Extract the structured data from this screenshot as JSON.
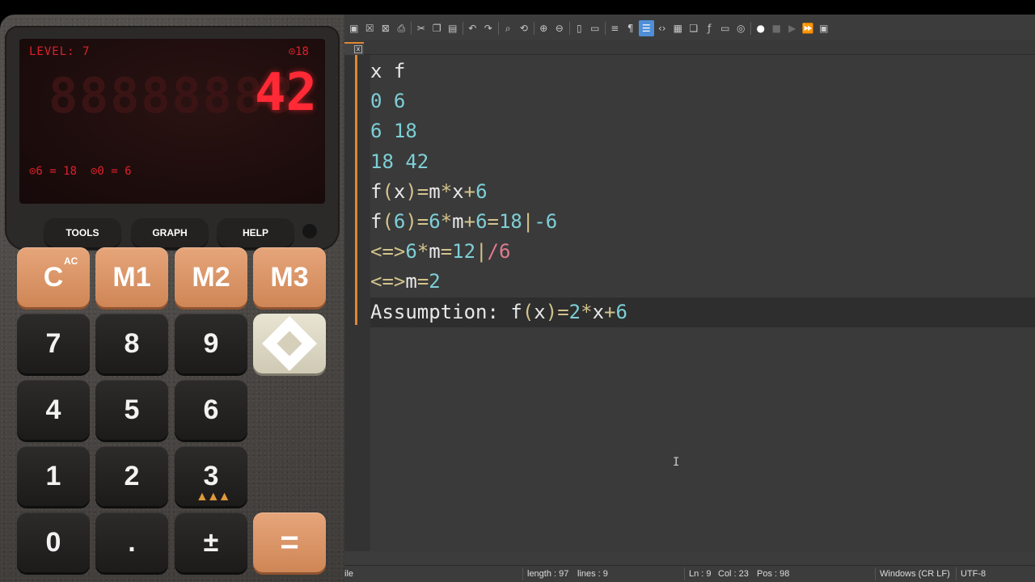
{
  "calculator": {
    "display": {
      "level": "LEVEL: 7",
      "top_right": "⊙18",
      "ghost_digits": "88888888",
      "value": "42",
      "memory_1": "⊙6 = 18",
      "memory_2": "⊙0 = 6"
    },
    "softkeys": [
      "TOOLS",
      "GRAPH",
      "HELP"
    ],
    "keys": {
      "clear": "C",
      "clear_sup": "AC",
      "m1": "M1",
      "m2": "M2",
      "m3": "M3",
      "seven": "7",
      "eight": "8",
      "nine": "9",
      "four": "4",
      "five": "5",
      "six": "6",
      "one": "1",
      "two": "2",
      "three": "3",
      "zero": "0",
      "dot": ".",
      "plus_minus": "±",
      "equals": "="
    },
    "colors": {
      "orange": "#dd996c",
      "dark_key": "#242322",
      "lcd_red": "#ff2a35"
    }
  },
  "editor": {
    "toolbar_icons": [
      "save-icon",
      "close-icon",
      "close-all-icon",
      "print-icon",
      "cut-icon",
      "copy-icon",
      "paste-icon",
      "undo-icon",
      "redo-icon",
      "find-icon",
      "replace-icon",
      "zoom-in-icon",
      "zoom-out-icon",
      "sync-v-icon",
      "sync-h-icon",
      "word-wrap-icon",
      "show-all-chars-icon",
      "indent-guide-icon",
      "language-icon",
      "document-map-icon",
      "document-list-icon",
      "function-list-icon",
      "monitor-icon",
      "folder-as-workspace-icon",
      "record-macro-icon",
      "stop-macro-icon",
      "play-macro-icon",
      "run-macro-multiple-icon",
      "save-macro-icon"
    ],
    "tab_close": "x",
    "lines": [
      [
        {
          "t": "x f",
          "c": "plain"
        }
      ],
      [
        {
          "t": "0 6",
          "c": "num"
        }
      ],
      [
        {
          "t": "6 18",
          "c": "num"
        }
      ],
      [
        {
          "t": "18 42",
          "c": "num"
        }
      ],
      [
        {
          "t": "f",
          "c": "plain"
        },
        {
          "t": "(",
          "c": "op"
        },
        {
          "t": "x",
          "c": "plain"
        },
        {
          "t": ")=",
          "c": "op"
        },
        {
          "t": "m",
          "c": "plain"
        },
        {
          "t": "*",
          "c": "op"
        },
        {
          "t": "x",
          "c": "plain"
        },
        {
          "t": "+",
          "c": "op"
        },
        {
          "t": "6",
          "c": "num"
        }
      ],
      [
        {
          "t": "f",
          "c": "plain"
        },
        {
          "t": "(",
          "c": "op"
        },
        {
          "t": "6",
          "c": "num"
        },
        {
          "t": ")=",
          "c": "op"
        },
        {
          "t": "6",
          "c": "num"
        },
        {
          "t": "*",
          "c": "op"
        },
        {
          "t": "m",
          "c": "plain"
        },
        {
          "t": "+",
          "c": "op"
        },
        {
          "t": "6",
          "c": "num"
        },
        {
          "t": "=",
          "c": "op"
        },
        {
          "t": "18",
          "c": "num"
        },
        {
          "t": "|",
          "c": "op"
        },
        {
          "t": "-6",
          "c": "num"
        }
      ],
      [
        {
          "t": "<=>",
          "c": "op"
        },
        {
          "t": "6",
          "c": "num"
        },
        {
          "t": "*",
          "c": "op"
        },
        {
          "t": "m",
          "c": "plain"
        },
        {
          "t": "=",
          "c": "op"
        },
        {
          "t": "12",
          "c": "num"
        },
        {
          "t": "|",
          "c": "op"
        },
        {
          "t": "/6",
          "c": "pink"
        }
      ],
      [
        {
          "t": "<=>",
          "c": "op"
        },
        {
          "t": "m",
          "c": "plain"
        },
        {
          "t": "=",
          "c": "op"
        },
        {
          "t": "2",
          "c": "num"
        }
      ],
      [
        {
          "t": "Assumption: f",
          "c": "plain"
        },
        {
          "t": "(",
          "c": "op"
        },
        {
          "t": "x",
          "c": "plain"
        },
        {
          "t": ")=",
          "c": "op"
        },
        {
          "t": "2",
          "c": "num"
        },
        {
          "t": "*",
          "c": "op"
        },
        {
          "t": "x",
          "c": "plain"
        },
        {
          "t": "+",
          "c": "op"
        },
        {
          "t": "6",
          "c": "num"
        }
      ]
    ],
    "current_line_index": 8,
    "statusbar": {
      "file_type": "ile",
      "length": "length : 97",
      "lines": "lines : 9",
      "ln": "Ln : 9",
      "col": "Col : 23",
      "pos": "Pos : 98",
      "eol": "Windows (CR LF)",
      "encoding": "UTF-8"
    }
  }
}
